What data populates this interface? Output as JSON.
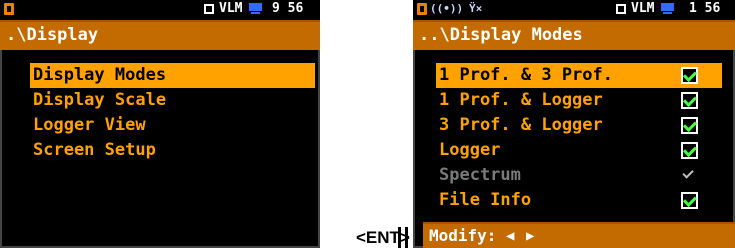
{
  "screen1": {
    "status": {
      "indicator": "VLM",
      "time": "9 56"
    },
    "title": ".\\Display",
    "items": [
      "Display Modes",
      "Display Scale",
      "Logger View",
      "Screen Setup"
    ]
  },
  "screen2": {
    "status": {
      "indicator": "VLM",
      "time": "1 56"
    },
    "title": "..\\Display Modes",
    "items": [
      {
        "label": "1 Prof. & 3 Prof.",
        "checked": true
      },
      {
        "label": "1 Prof. & Logger",
        "checked": true
      },
      {
        "label": "3 Prof. & Logger",
        "checked": true
      },
      {
        "label": "Logger",
        "checked": true
      },
      {
        "label": "Spectrum",
        "checked": true,
        "disabled": true
      },
      {
        "label": "File Info",
        "checked": true
      }
    ],
    "footer": "Modify:"
  },
  "key_label": "<ENT>",
  "colors": {
    "accent": "#ffa200",
    "title_bar": "#c36a00",
    "check": "#3fff3f"
  }
}
